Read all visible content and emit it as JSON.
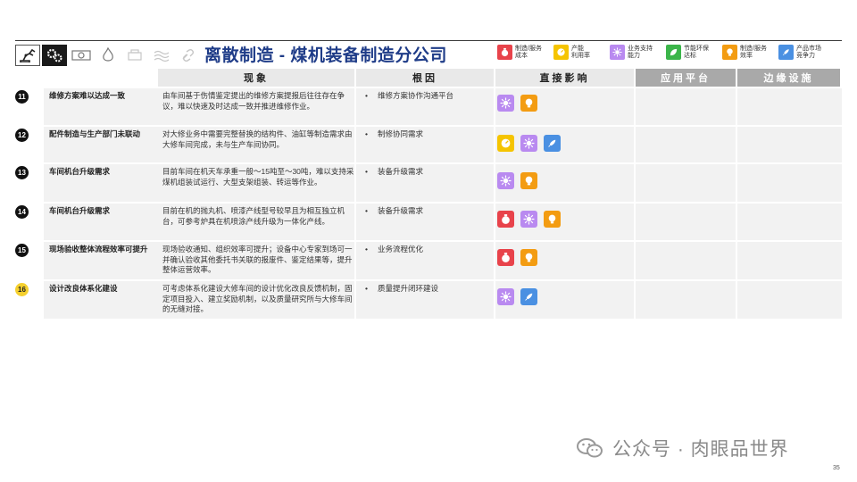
{
  "header": {
    "title": "离散制造 - 煤机装备制造分公司",
    "icons": [
      "robot-arm-icon",
      "gears-icon",
      "machine-icon",
      "fire-icon",
      "printer-icon",
      "waves-icon",
      "chain-icon"
    ]
  },
  "legend": [
    {
      "key": "cost",
      "label": "制造/服务\n成本",
      "color": "#e8434b",
      "icon": "money-bag-icon"
    },
    {
      "key": "capacity",
      "label": "产能\n利用率",
      "color": "#f5c400",
      "icon": "gauge-icon"
    },
    {
      "key": "business",
      "label": "业务支持\n能力",
      "color": "#b98af0",
      "icon": "settings-burst-icon"
    },
    {
      "key": "green",
      "label": "节能环保\n达标",
      "color": "#3bb54a",
      "icon": "leaf-icon"
    },
    {
      "key": "efficiency",
      "label": "制造/服务\n效率",
      "color": "#f39c12",
      "icon": "lightbulb-icon"
    },
    {
      "key": "market",
      "label": "产品市场\n竞争力",
      "color": "#4a90e2",
      "icon": "rocket-icon"
    }
  ],
  "columns": {
    "phenomenon": "现象",
    "cause": "根因",
    "impact": "直接影响",
    "platform": "应用平台",
    "edge": "边缘设施"
  },
  "rows": [
    {
      "num": "11",
      "issue": "维修方案难以达成一致",
      "phenomenon": "由车间基于伤情鉴定提出的维修方案提报后往往存在争议，难以快速及时达成一致并推进维修作业。",
      "cause": "维修方案协作沟通平台",
      "impacts": [
        "business",
        "efficiency"
      ]
    },
    {
      "num": "12",
      "issue": "配件制造与生产部门未联动",
      "phenomenon": "对大修业务中需要完整替换的结构件、油缸等制造需求由大修车间完成，未与生产车间协同。",
      "cause": "制修协同需求",
      "impacts": [
        "capacity",
        "business",
        "market"
      ]
    },
    {
      "num": "13",
      "issue": "车间机台升级需求",
      "phenomenon": "目前车间在机天车承重一般～15吨至～30吨，难以支持采煤机组装试运行、大型支架组装、转运等作业。",
      "cause": "装备升级需求",
      "impacts": [
        "business",
        "efficiency"
      ]
    },
    {
      "num": "14",
      "issue": "车间机台升级需求",
      "phenomenon": "目前在机的抛丸机、喷漆产线型号较早且为相互独立机台，可参考炉具在机喷涂产线升级为一体化产线。",
      "cause": "装备升级需求",
      "impacts": [
        "cost",
        "business",
        "efficiency"
      ]
    },
    {
      "num": "15",
      "issue": "现场验收整体流程效率可提升",
      "phenomenon": "现场验收通知、组织效率可提升；设备中心专家到场可一并确认验收其他委托书关联的报废件、鉴定结果等，提升整体运营效率。",
      "cause": "业务流程优化",
      "impacts": [
        "cost",
        "efficiency"
      ]
    },
    {
      "num": "16",
      "issue": "设计改良体系化建设",
      "phenomenon": "可考虑体系化建设大修车间的设计优化改良反馈机制，固定项目投入、建立奖励机制，以及质量研究所与大修车间的无缝对接。",
      "cause": "质量提升闭环建设",
      "impacts": [
        "business",
        "market"
      ]
    }
  ],
  "watermark": "公众号 · 肉眼品世界",
  "page_number": "35"
}
